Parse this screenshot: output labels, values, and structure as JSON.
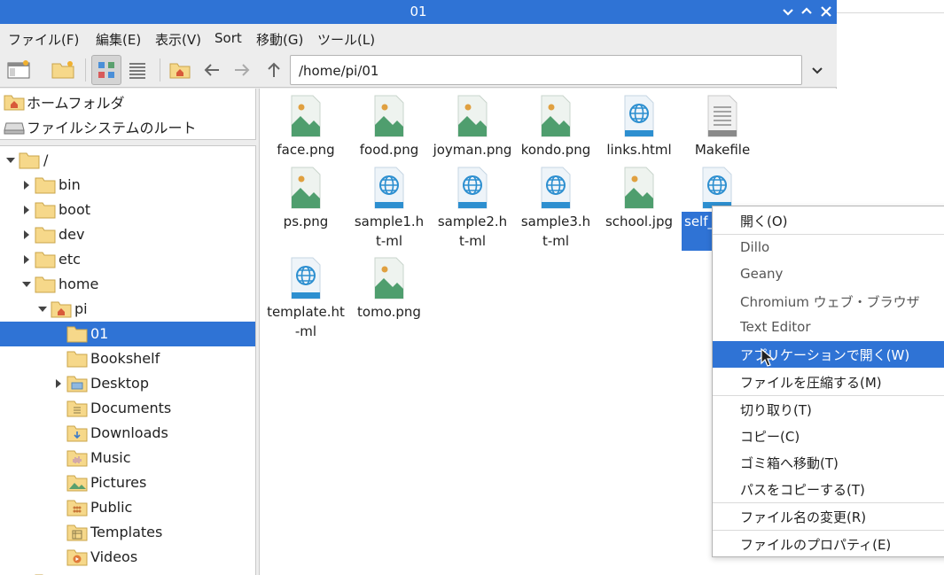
{
  "window": {
    "title": "01"
  },
  "menubar": [
    "ファイル(F)",
    "編集(E)",
    "表示(V)",
    "Sort",
    "移動(G)",
    "ツール(L)"
  ],
  "toolbar": {
    "path": "/home/pi/01",
    "buttons": [
      "new-window-icon",
      "new-folder-icon",
      "icon-view-icon",
      "list-view-icon",
      "home-icon",
      "back-arrow-icon",
      "forward-arrow-icon",
      "up-arrow-icon",
      "path-dropdown-icon"
    ]
  },
  "places": [
    {
      "label": "ホームフォルダ",
      "icon": "home-folder-icon"
    },
    {
      "label": "ファイルシステムのルート",
      "icon": "drive-icon"
    }
  ],
  "tree": [
    {
      "label": "/",
      "expanded": true
    },
    {
      "label": "bin"
    },
    {
      "label": "boot"
    },
    {
      "label": "dev"
    },
    {
      "label": "etc"
    },
    {
      "label": "home",
      "expanded": true
    },
    {
      "label": "pi",
      "expanded": true
    },
    {
      "label": "01",
      "selected": true
    },
    {
      "label": "Bookshelf"
    },
    {
      "label": "Desktop"
    },
    {
      "label": "Documents"
    },
    {
      "label": "Downloads"
    },
    {
      "label": "Music"
    },
    {
      "label": "Pictures"
    },
    {
      "label": "Public"
    },
    {
      "label": "Templates"
    },
    {
      "label": "Videos"
    }
  ],
  "files": [
    {
      "name": "face.png",
      "type": "image"
    },
    {
      "name": "food.png",
      "type": "image"
    },
    {
      "name": "joyman.png",
      "type": "image"
    },
    {
      "name": "kondo.png",
      "type": "image"
    },
    {
      "name": "links.html",
      "type": "html"
    },
    {
      "name": "Makefile",
      "type": "text"
    },
    {
      "name": "ps.png",
      "type": "image"
    },
    {
      "name": "sample1.ht-ml",
      "type": "html"
    },
    {
      "name": "sample2.ht-ml",
      "type": "html"
    },
    {
      "name": "sample3.ht-ml",
      "type": "html"
    },
    {
      "name": "school.jpg",
      "type": "image"
    },
    {
      "name": "self_",
      "type": "html",
      "selected": true
    },
    {
      "name": "template.ht-ml",
      "type": "html"
    },
    {
      "name": "tomo.png",
      "type": "image"
    }
  ],
  "context_menu": [
    {
      "label": "開く(O)"
    },
    {
      "label": "Dillo",
      "dim": true
    },
    {
      "label": "Geany",
      "dim": true
    },
    {
      "label": "Chromium ウェブ・ブラウザ",
      "dim": true
    },
    {
      "label": "Text Editor",
      "dim": true
    },
    {
      "label": "アプリケーションで開く(W)",
      "highlighted": true
    },
    {
      "label": "ファイルを圧縮する(M)"
    },
    {
      "label": "切り取り(T)"
    },
    {
      "label": "コピー(C)"
    },
    {
      "label": "ゴミ箱へ移動(T)"
    },
    {
      "label": "パスをコピーする(T)"
    },
    {
      "label": "ファイル名の変更(R)"
    },
    {
      "label": "ファイルのプロパティ(E)"
    }
  ],
  "colors": {
    "accent": "#2f73d5",
    "folder": "#f6d88a",
    "image_icon": "#4f9e6e",
    "html_icon": "#2d8fd0"
  }
}
